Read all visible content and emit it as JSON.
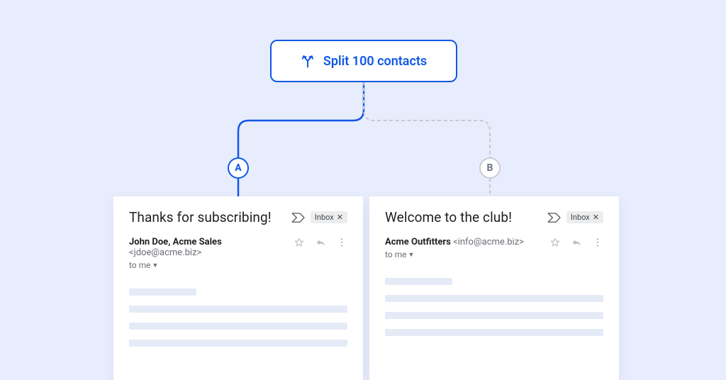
{
  "split_node": {
    "label": "Split 100 contacts"
  },
  "variants": {
    "a": {
      "letter": "A"
    },
    "b": {
      "letter": "B"
    }
  },
  "emails": {
    "a": {
      "subject": "Thanks for subscribing!",
      "inbox_label": "Inbox",
      "sender_name": "John Doe, Acme Sales",
      "sender_email": "<jdoe@acme.biz>",
      "recipient_line": "to me"
    },
    "b": {
      "subject": "Welcome to the club!",
      "inbox_label": "Inbox",
      "sender_name": "Acme Outfitters",
      "sender_email": "<info@acme.biz>",
      "recipient_line": "to me"
    }
  }
}
